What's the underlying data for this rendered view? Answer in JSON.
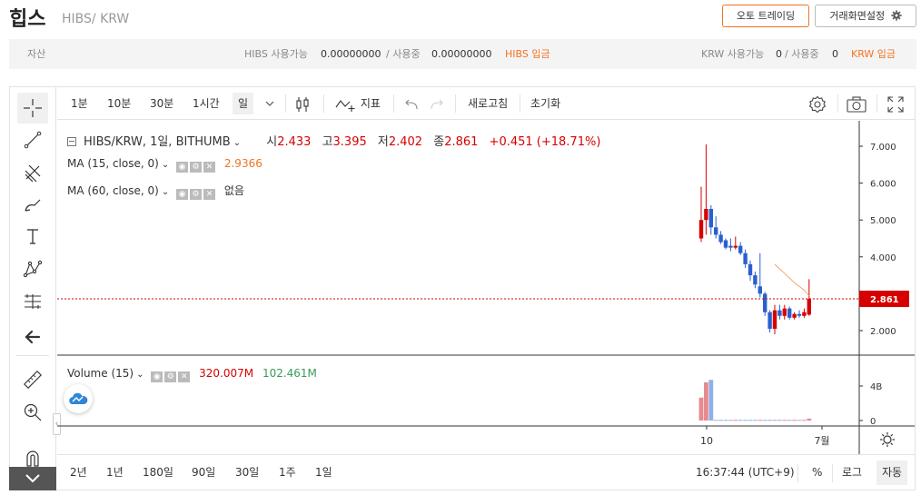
{
  "header": {
    "coin_name": "힙스",
    "pair": "HIBS/ KRW",
    "auto_trade_label": "오토 트레이딩",
    "screen_settings_label": "거래화면설정"
  },
  "asset_bar": {
    "asset_label": "자산",
    "hibs_available_label": "HIBS 사용가능",
    "hibs_available": "0.00000000",
    "hibs_in_use_label": "/ 사용중",
    "hibs_in_use": "0.00000000",
    "hibs_deposit": "HIBS 입금",
    "krw_available_label": "KRW 사용가능",
    "krw_available": "0",
    "krw_in_use_label": "/ 사용중",
    "krw_in_use": "0",
    "krw_deposit": "KRW 입금"
  },
  "toolbar": {
    "intervals": [
      "1분",
      "10분",
      "30분",
      "1시간",
      "일"
    ],
    "selected_interval": "일",
    "indicator_label": "지표",
    "refresh_label": "새로고침",
    "reset_label": "초기화"
  },
  "legend": {
    "symbol": "HIBS/KRW, 1일, BITHUMB",
    "open_label": "시",
    "open": "2.433",
    "high_label": "고",
    "high": "3.395",
    "low_label": "저",
    "low": "2.402",
    "close_label": "종",
    "close": "2.861",
    "change": "+0.451 (+18.71%)",
    "ma15_label": "MA (15, close, 0)",
    "ma15_value": "2.9366",
    "ma60_label": "MA (60, close, 0)",
    "ma60_value": "없음",
    "volume_label": "Volume (15)",
    "volume_value1": "320.007M",
    "volume_value2": "102.461M"
  },
  "bottom": {
    "ranges": [
      "2년",
      "1년",
      "180일",
      "90일",
      "30일",
      "1주",
      "1일"
    ],
    "clock": "16:37:44 (UTC+9)",
    "percent_label": "%",
    "log_label": "로그",
    "auto_label": "자동"
  },
  "colors": {
    "up": "#d60000",
    "down": "#2a5fd0",
    "accent": "#f37321",
    "ma15": "#f4a26c"
  },
  "chart_data": {
    "type": "candlestick",
    "price_axis": {
      "ticks": [
        "2.000",
        "3.000",
        "4.000",
        "5.000",
        "6.000",
        "7.000"
      ],
      "current_price_label": "2.861"
    },
    "volume_axis": {
      "ticks": [
        "0",
        "4B"
      ]
    },
    "time_axis": {
      "ticks": [
        "10",
        "7월"
      ]
    },
    "candles": [
      {
        "o": 4.5,
        "h": 5.9,
        "l": 4.4,
        "c": 5.0
      },
      {
        "o": 5.0,
        "h": 7.05,
        "l": 4.6,
        "c": 5.3
      },
      {
        "o": 5.3,
        "h": 5.4,
        "l": 4.6,
        "c": 4.8
      },
      {
        "o": 4.8,
        "h": 5.1,
        "l": 4.5,
        "c": 4.6
      },
      {
        "o": 4.6,
        "h": 4.7,
        "l": 4.35,
        "c": 4.4
      },
      {
        "o": 4.45,
        "h": 4.5,
        "l": 4.2,
        "c": 4.25
      },
      {
        "o": 4.3,
        "h": 4.5,
        "l": 4.15,
        "c": 4.25
      },
      {
        "o": 4.25,
        "h": 4.55,
        "l": 4.2,
        "c": 4.3
      },
      {
        "o": 4.3,
        "h": 4.4,
        "l": 4.05,
        "c": 4.1
      },
      {
        "o": 4.1,
        "h": 4.2,
        "l": 3.7,
        "c": 3.8
      },
      {
        "o": 3.8,
        "h": 3.9,
        "l": 3.35,
        "c": 3.5
      },
      {
        "o": 3.5,
        "h": 3.6,
        "l": 3.15,
        "c": 3.25
      },
      {
        "o": 3.2,
        "h": 4.1,
        "l": 2.9,
        "c": 3.0
      },
      {
        "o": 3.0,
        "h": 3.05,
        "l": 2.4,
        "c": 2.5
      },
      {
        "o": 2.5,
        "h": 2.55,
        "l": 1.95,
        "c": 2.05
      },
      {
        "o": 2.05,
        "h": 2.7,
        "l": 1.9,
        "c": 2.55
      },
      {
        "o": 2.55,
        "h": 2.7,
        "l": 2.3,
        "c": 2.4
      },
      {
        "o": 2.4,
        "h": 2.7,
        "l": 2.3,
        "c": 2.6
      },
      {
        "o": 2.6,
        "h": 2.65,
        "l": 2.3,
        "c": 2.35
      },
      {
        "o": 2.35,
        "h": 2.5,
        "l": 2.3,
        "c": 2.45
      },
      {
        "o": 2.45,
        "h": 2.55,
        "l": 2.35,
        "c": 2.4
      },
      {
        "o": 2.4,
        "h": 2.6,
        "l": 2.35,
        "c": 2.5
      },
      {
        "o": 2.433,
        "h": 3.395,
        "l": 2.402,
        "c": 2.861
      }
    ],
    "volumes": [
      {
        "v": 1.8,
        "up": true
      },
      {
        "v": 3.0,
        "up": true
      },
      {
        "v": 3.2,
        "up": false
      },
      {
        "v": 0.05,
        "up": false
      },
      {
        "v": 0.05,
        "up": false
      },
      {
        "v": 0.05,
        "up": false
      },
      {
        "v": 0.05,
        "up": false
      },
      {
        "v": 0.05,
        "up": true
      },
      {
        "v": 0.05,
        "up": false
      },
      {
        "v": 0.05,
        "up": false
      },
      {
        "v": 0.05,
        "up": false
      },
      {
        "v": 0.05,
        "up": false
      },
      {
        "v": 0.05,
        "up": true
      },
      {
        "v": 0.05,
        "up": false
      },
      {
        "v": 0.05,
        "up": false
      },
      {
        "v": 0.05,
        "up": true
      },
      {
        "v": 0.05,
        "up": false
      },
      {
        "v": 0.05,
        "up": true
      },
      {
        "v": 0.05,
        "up": false
      },
      {
        "v": 0.05,
        "up": true
      },
      {
        "v": 0.05,
        "up": false
      },
      {
        "v": 0.05,
        "up": true
      },
      {
        "v": 0.15,
        "up": true
      }
    ],
    "ma15": [
      {
        "i": 15,
        "y": 3.8
      },
      {
        "i": 17,
        "y": 3.55
      },
      {
        "i": 19,
        "y": 3.3
      },
      {
        "i": 21,
        "y": 3.1
      },
      {
        "i": 22,
        "y": 2.9366
      }
    ]
  }
}
